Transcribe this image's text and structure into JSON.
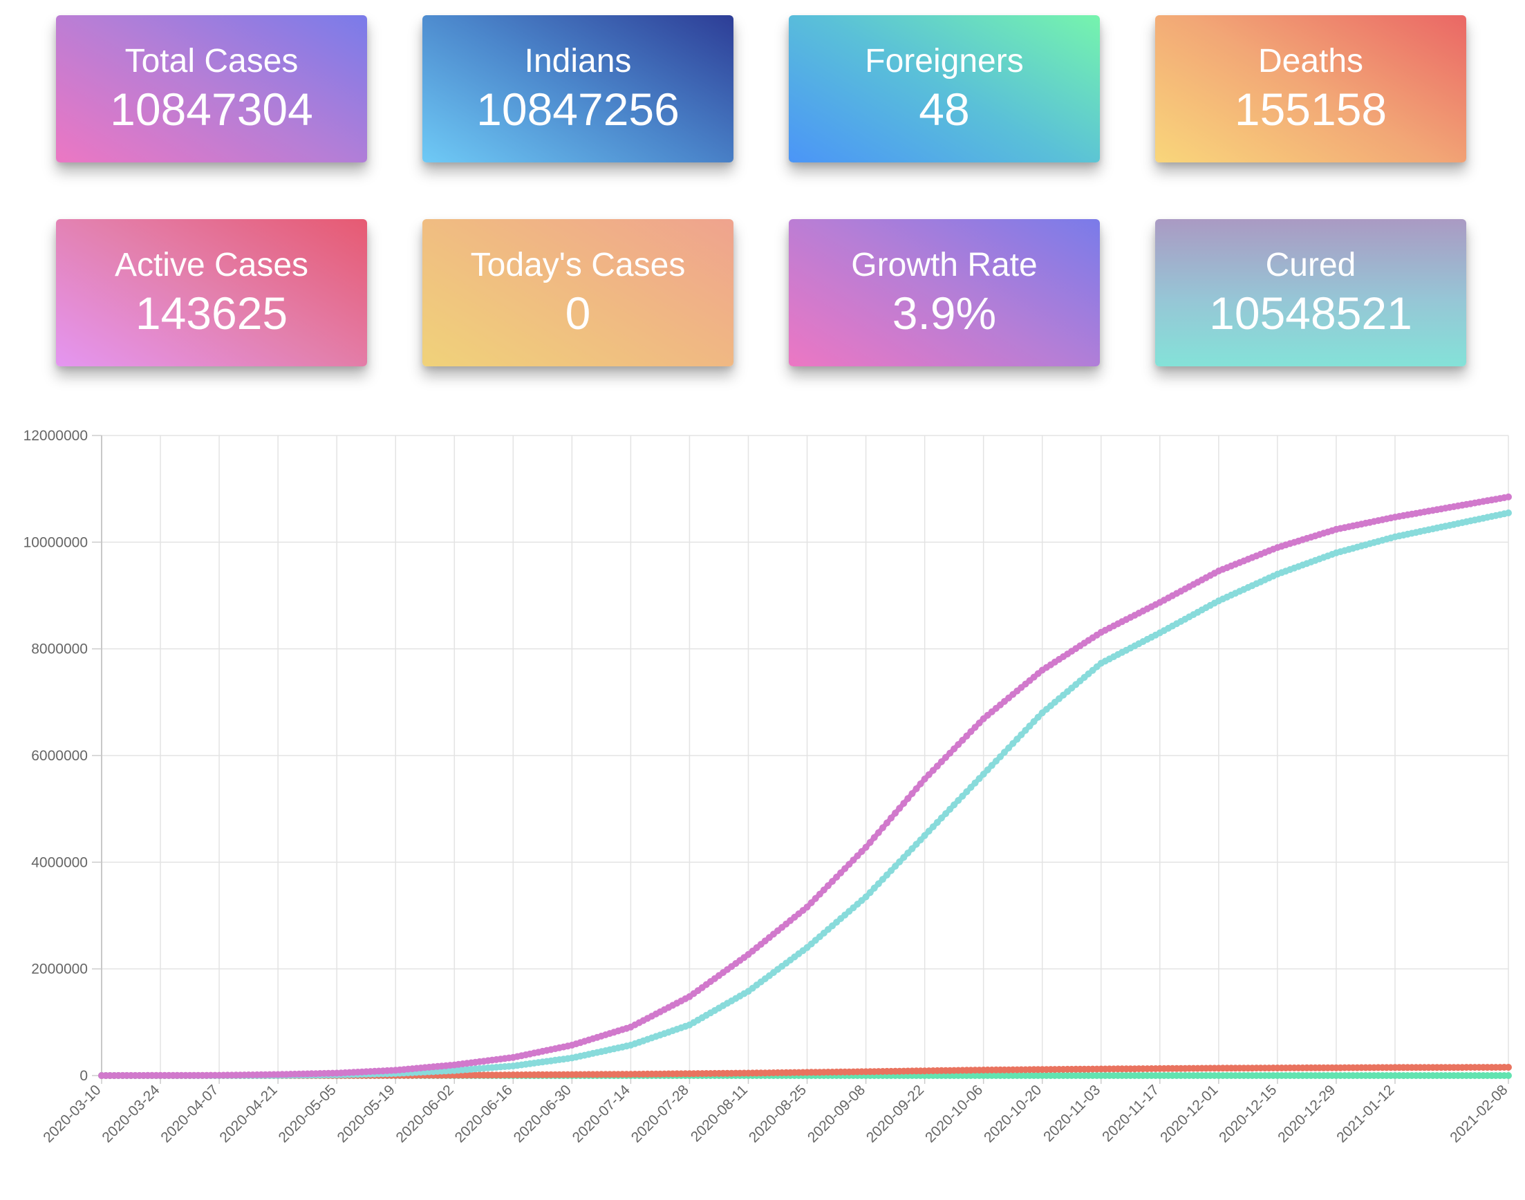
{
  "cards": [
    {
      "label": "Total Cases",
      "value": "10847304"
    },
    {
      "label": "Indians",
      "value": "10847256"
    },
    {
      "label": "Foreigners",
      "value": "48"
    },
    {
      "label": "Deaths",
      "value": "155158"
    },
    {
      "label": "Active Cases",
      "value": "143625"
    },
    {
      "label": "Today's Cases",
      "value": "0"
    },
    {
      "label": "Growth Rate",
      "value": "3.9%"
    },
    {
      "label": "Cured",
      "value": "10548521"
    }
  ],
  "chart_data": {
    "type": "line",
    "title": "",
    "xlabel": "",
    "ylabel": "",
    "ylim": [
      0,
      12000000
    ],
    "yticks": [
      0,
      2000000,
      4000000,
      6000000,
      8000000,
      10000000,
      12000000
    ],
    "xlim": [
      "2020-03-10",
      "2021-02-08"
    ],
    "xticks": [
      "2020-03-10",
      "2020-03-24",
      "2020-04-07",
      "2020-04-21",
      "2020-05-05",
      "2020-05-19",
      "2020-06-02",
      "2020-06-16",
      "2020-06-30",
      "2020-07-14",
      "2020-07-28",
      "2020-08-11",
      "2020-08-25",
      "2020-09-08",
      "2020-09-22",
      "2020-10-06",
      "2020-10-20",
      "2020-11-03",
      "2020-11-17",
      "2020-12-01",
      "2020-12-15",
      "2020-12-29",
      "2021-01-12",
      "2021-02-08"
    ],
    "grid": true,
    "legend": "none",
    "series": [
      {
        "color": "#d179cc",
        "points": [
          [
            "2020-03-10",
            50
          ],
          [
            "2020-04-07",
            5000
          ],
          [
            "2020-04-21",
            20000
          ],
          [
            "2020-05-05",
            46000
          ],
          [
            "2020-05-19",
            100000
          ],
          [
            "2020-06-02",
            200000
          ],
          [
            "2020-06-16",
            340000
          ],
          [
            "2020-06-30",
            570000
          ],
          [
            "2020-07-14",
            910000
          ],
          [
            "2020-07-28",
            1480000
          ],
          [
            "2020-08-11",
            2270000
          ],
          [
            "2020-08-25",
            3160000
          ],
          [
            "2020-09-08",
            4280000
          ],
          [
            "2020-09-22",
            5560000
          ],
          [
            "2020-10-06",
            6690000
          ],
          [
            "2020-10-20",
            7600000
          ],
          [
            "2020-11-03",
            8310000
          ],
          [
            "2020-11-17",
            8870000
          ],
          [
            "2020-12-01",
            9460000
          ],
          [
            "2020-12-15",
            9900000
          ],
          [
            "2020-12-29",
            10240000
          ],
          [
            "2021-01-12",
            10470000
          ],
          [
            "2021-02-08",
            10847304
          ]
        ]
      },
      {
        "color": "#88dbdb",
        "points": [
          [
            "2020-03-10",
            0
          ],
          [
            "2020-04-07",
            500
          ],
          [
            "2020-04-21",
            4000
          ],
          [
            "2020-05-05",
            13000
          ],
          [
            "2020-05-19",
            40000
          ],
          [
            "2020-06-02",
            95000
          ],
          [
            "2020-06-16",
            180000
          ],
          [
            "2020-06-30",
            330000
          ],
          [
            "2020-07-14",
            570000
          ],
          [
            "2020-07-28",
            950000
          ],
          [
            "2020-08-11",
            1580000
          ],
          [
            "2020-08-25",
            2400000
          ],
          [
            "2020-09-08",
            3350000
          ],
          [
            "2020-09-22",
            4500000
          ],
          [
            "2020-10-06",
            5650000
          ],
          [
            "2020-10-20",
            6800000
          ],
          [
            "2020-11-03",
            7730000
          ],
          [
            "2020-11-17",
            8300000
          ],
          [
            "2020-12-01",
            8900000
          ],
          [
            "2020-12-15",
            9400000
          ],
          [
            "2020-12-29",
            9800000
          ],
          [
            "2021-01-12",
            10100000
          ],
          [
            "2021-02-08",
            10548521
          ]
        ]
      },
      {
        "color": "#e9735f",
        "points": [
          [
            "2020-03-10",
            0
          ],
          [
            "2020-05-05",
            1700
          ],
          [
            "2020-06-02",
            6000
          ],
          [
            "2020-07-14",
            25000
          ],
          [
            "2020-08-11",
            46000
          ],
          [
            "2020-09-08",
            73000
          ],
          [
            "2020-10-06",
            104000
          ],
          [
            "2020-11-03",
            123000
          ],
          [
            "2020-12-01",
            138000
          ],
          [
            "2021-01-12",
            151000
          ],
          [
            "2021-02-08",
            155158
          ]
        ]
      },
      {
        "color": "#62e3b0",
        "points": [
          [
            "2020-03-10",
            0
          ],
          [
            "2021-02-08",
            48
          ]
        ]
      }
    ]
  }
}
